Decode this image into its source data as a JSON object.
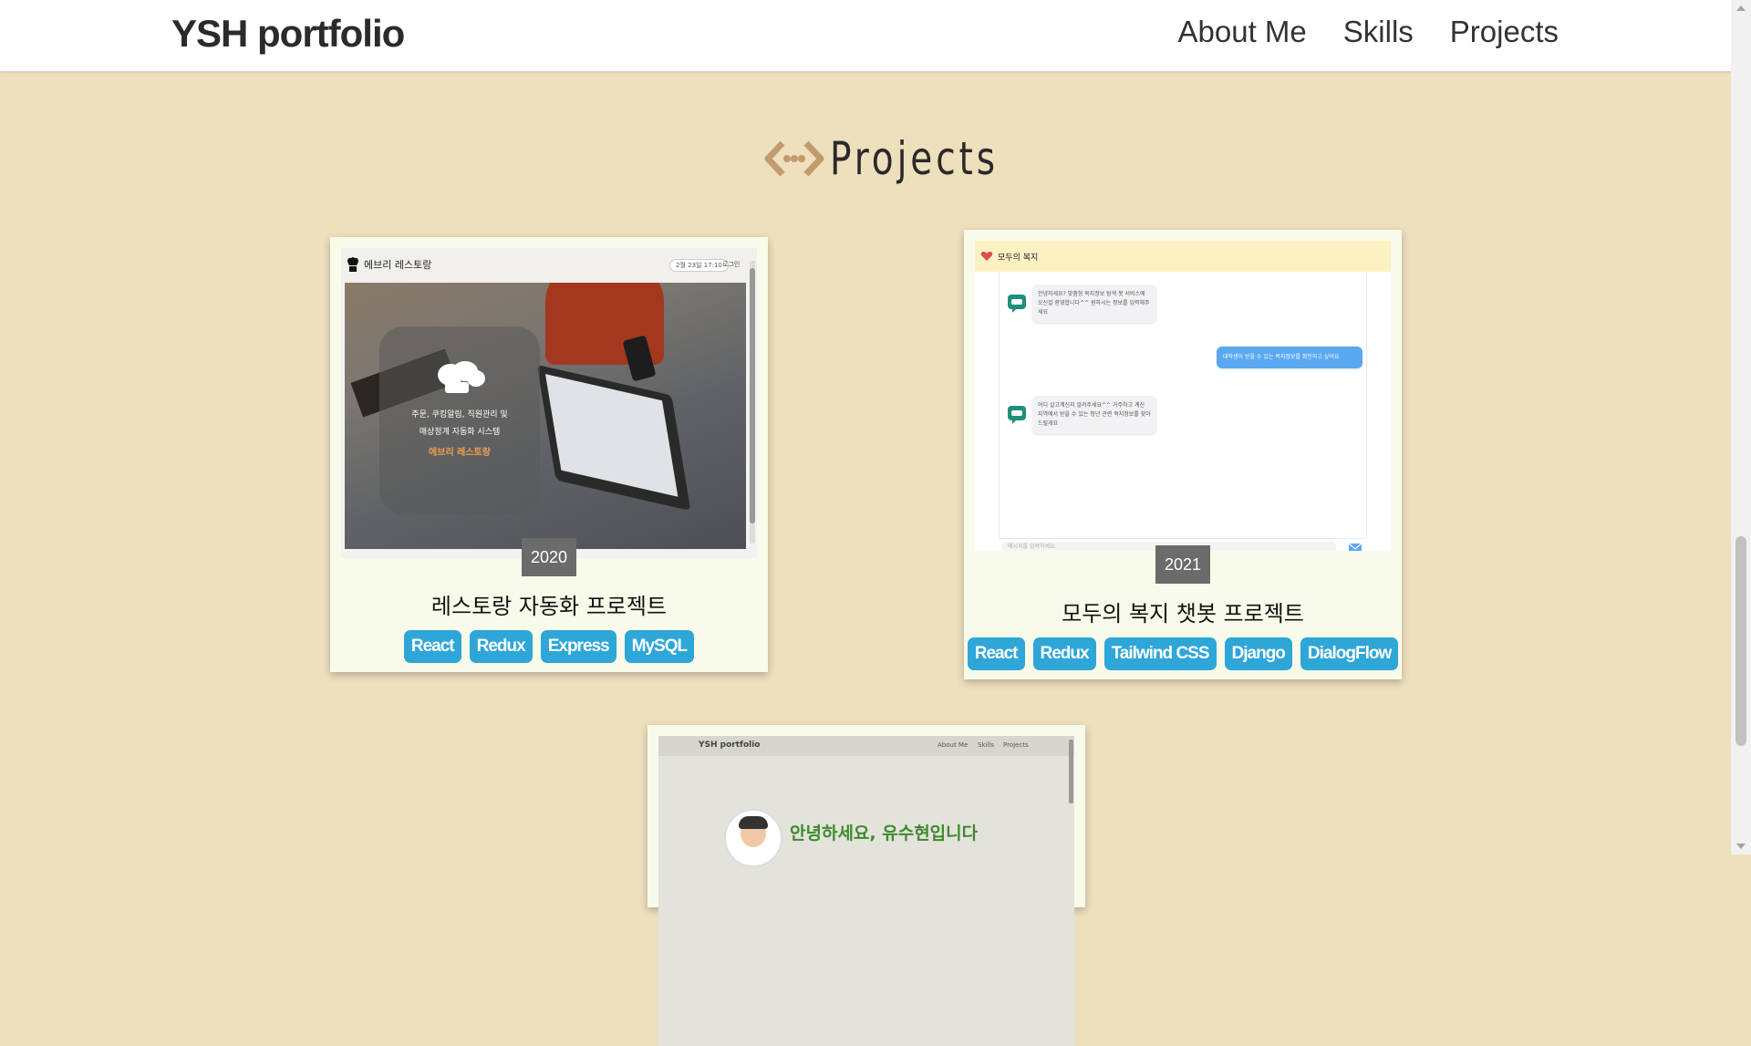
{
  "nav": {
    "brand": "YSH portfolio",
    "links": [
      "About Me",
      "Skills",
      "Projects"
    ]
  },
  "section": {
    "title": "Projects",
    "icon": "code-arrows-icon"
  },
  "projects": [
    {
      "year": "2020",
      "title": "레스토랑 자동화 프로젝트",
      "tags": [
        "React",
        "Redux",
        "Express",
        "MySQL"
      ],
      "screenshot": {
        "app_name": "에브리 레스토랑",
        "date_chip": "2월 23일 17:10",
        "login": "로그인",
        "overlay_line1": "주문, 쿠킹알림, 직원관리 및",
        "overlay_line2": "매상정계 자동화 시스템",
        "overlay_brand": "에브리 레스토랑"
      }
    },
    {
      "year": "2021",
      "title": "모두의 복지 챗봇 프로젝트",
      "tags": [
        "React",
        "Redux",
        "Tailwind CSS",
        "Django",
        "DialogFlow"
      ],
      "screenshot": {
        "app_name": "모두의 복지",
        "bot_msg_1": "안녕하세요? 맞춤형 복지정보 탐색 봇 서비스에 오신걸 환영합니다^^ 원하시는 정보를 입력해주세요",
        "user_msg": "대학생이 받을 수 있는 복지정보를 확인하고 싶어요",
        "bot_msg_2": "어디 살고계신지 알려주세요^^ 거주하고 계신 지역에서 받을 수 있는 청년 관련 복지정보를 찾아드릴게요",
        "input_placeholder": "메시지를 입력하세요."
      }
    },
    {
      "screenshot": {
        "brand": "YSH portfolio",
        "links": [
          "About Me",
          "Skills",
          "Projects"
        ],
        "greeting": "안녕하세요, 유수현입니다"
      }
    }
  ],
  "colors": {
    "background": "#eedfbd",
    "card": "#f8fbea",
    "tag": "#2ea6d8",
    "accent_icon": "#c19b6c"
  }
}
